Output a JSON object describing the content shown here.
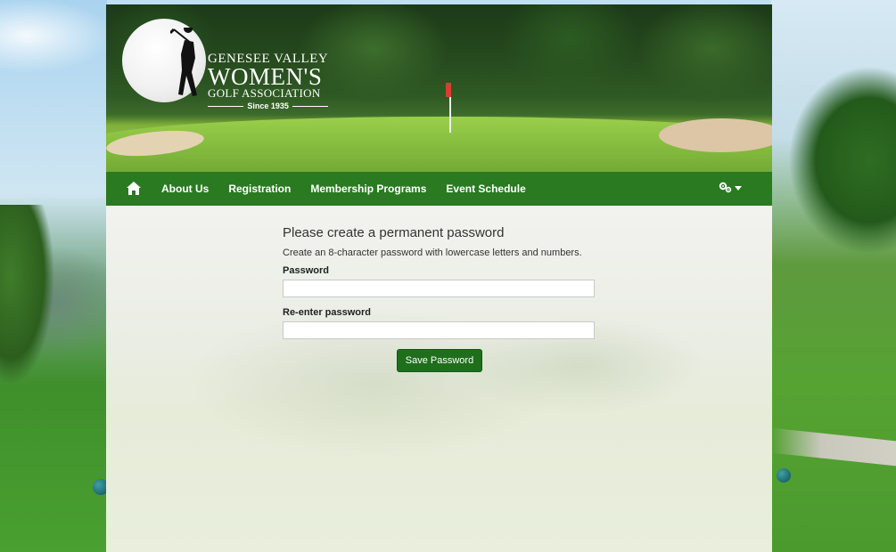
{
  "logo": {
    "line1": "GENESEE VALLEY",
    "line2": "WOMEN'S",
    "line3": "GOLF ASSOCIATION",
    "line4": "Since 1935"
  },
  "nav": {
    "items": [
      {
        "label": "About Us"
      },
      {
        "label": "Registration"
      },
      {
        "label": "Membership Programs"
      },
      {
        "label": "Event Schedule"
      }
    ],
    "home_icon": "home-icon",
    "settings_icon": "gears-icon"
  },
  "form": {
    "title": "Please create a permanent password",
    "description": "Create an 8-character password with lowercase letters and numbers.",
    "password_label": "Password",
    "password_value": "",
    "reenter_label": "Re-enter password",
    "reenter_value": "",
    "submit_label": "Save Password"
  },
  "colors": {
    "nav_green": "#2a7a22",
    "button_green": "#1f6e1c"
  }
}
